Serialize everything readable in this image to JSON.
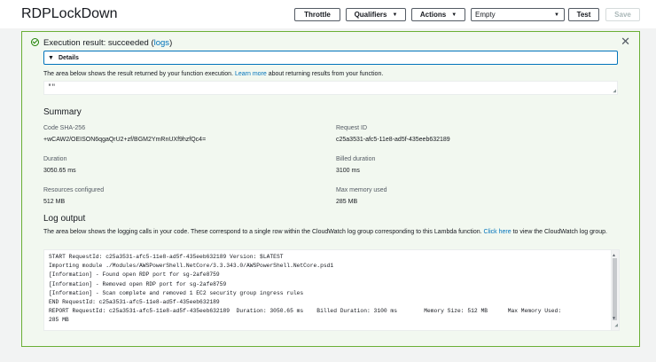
{
  "header": {
    "function_name": "RDPLockDown",
    "throttle_label": "Throttle",
    "qualifiers_label": "Qualifiers",
    "actions_label": "Actions",
    "test_event_selected": "Empty",
    "test_label": "Test",
    "save_label": "Save"
  },
  "result": {
    "status_prefix": "Execution result: succeeded (",
    "logs_link": "logs",
    "status_suffix": ")",
    "details_label": "Details",
    "description_prefix": "The area below shows the result returned by your function execution. ",
    "learn_more_link": "Learn more",
    "description_suffix": " about returning results from your function.",
    "output": "\"\""
  },
  "summary": {
    "title": "Summary",
    "code_sha_label": "Code SHA-256",
    "code_sha_value": "+wCAW2/OEISON6qgaQrU2+zf/BGM2YmRnUXf9hzfQc4=",
    "request_id_label": "Request ID",
    "request_id_value": "c25a3531-afc5-11e8-ad5f-435eeb632189",
    "duration_label": "Duration",
    "duration_value": "3050.65 ms",
    "billed_duration_label": "Billed duration",
    "billed_duration_value": "3100 ms",
    "resources_label": "Resources configured",
    "resources_value": "512 MB",
    "max_memory_label": "Max memory used",
    "max_memory_value": "285 MB"
  },
  "log_output": {
    "title": "Log output",
    "description_prefix": "The area below shows the logging calls in your code. These correspond to a single row within the CloudWatch log group corresponding to this Lambda function. ",
    "click_here_link": "Click here",
    "description_suffix": " to view the CloudWatch log group.",
    "lines": [
      "START RequestId: c25a3531-afc5-11e8-ad5f-435eeb632189 Version: $LATEST",
      "Importing module ./Modules/AWSPowerShell.NetCore/3.3.343.0/AWSPowerShell.NetCore.psd1",
      "[Information] - Found open RDP port for sg-2afe8759",
      "[Information] - Removed open RDP port for sg-2afe8759",
      "[Information] - Scan complete and removed 1 EC2 security group ingress rules",
      "END RequestId: c25a3531-afc5-11e8-ad5f-435eeb632189",
      "REPORT RequestId: c25a3531-afc5-11e8-ad5f-435eeb632189  Duration: 3050.65 ms    Billed Duration: 3100 ms        Memory Size: 512 MB      Max Memory Used:",
      "285 MB"
    ]
  },
  "colors": {
    "success_border": "#6aaf35",
    "success_bg": "#f2f8f0",
    "link": "#0073bb"
  },
  "icons": {
    "status": "check-circle-icon",
    "close": "close-icon",
    "details_toggle": "caret-down-icon"
  }
}
